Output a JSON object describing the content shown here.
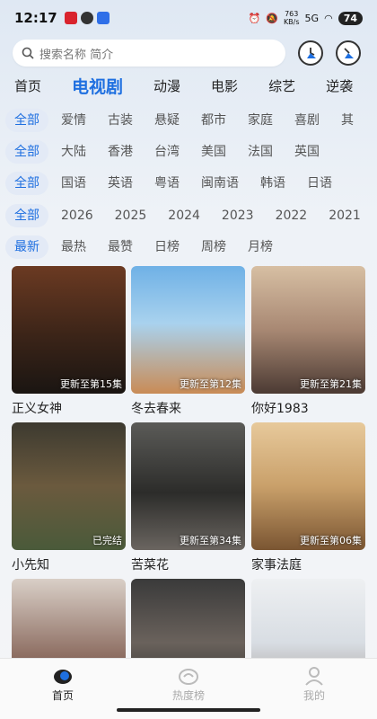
{
  "status": {
    "time": "12:17",
    "netspeed_value": "763",
    "netspeed_unit": "KB/s",
    "signal": "5G",
    "battery": "74"
  },
  "search": {
    "placeholder": "搜索名称 简介"
  },
  "main_tabs": [
    {
      "label": "首页"
    },
    {
      "label": "电视剧"
    },
    {
      "label": "动漫"
    },
    {
      "label": "电影"
    },
    {
      "label": "综艺"
    },
    {
      "label": "逆袭"
    }
  ],
  "filters": {
    "genre": [
      "全部",
      "爱情",
      "古装",
      "悬疑",
      "都市",
      "家庭",
      "喜剧",
      "其"
    ],
    "region": [
      "全部",
      "大陆",
      "香港",
      "台湾",
      "美国",
      "法国",
      "英国"
    ],
    "language": [
      "全部",
      "国语",
      "英语",
      "粤语",
      "闽南语",
      "韩语",
      "日语"
    ],
    "year": [
      "全部",
      "2026",
      "2025",
      "2024",
      "2023",
      "2022",
      "2021"
    ],
    "sort": [
      "最新",
      "最热",
      "最赞",
      "日榜",
      "周榜",
      "月榜"
    ]
  },
  "cards": [
    {
      "title": "正义女神",
      "badge": "更新至第15集"
    },
    {
      "title": "冬去春来",
      "badge": "更新至第12集"
    },
    {
      "title": "你好1983",
      "badge": "更新至第21集"
    },
    {
      "title": "小先知",
      "badge": "已完结"
    },
    {
      "title": "苦菜花",
      "badge": "更新至第34集"
    },
    {
      "title": "家事法庭",
      "badge": "更新至第06集"
    },
    {
      "title": "",
      "badge": ""
    },
    {
      "title": "",
      "badge": ""
    },
    {
      "title": "",
      "badge": ""
    }
  ],
  "bottom_nav": [
    {
      "label": "首页"
    },
    {
      "label": "热度榜"
    },
    {
      "label": "我的"
    }
  ],
  "colors": {
    "accent": "#1e6fe0",
    "chip_bg": "#e3eaf6"
  }
}
